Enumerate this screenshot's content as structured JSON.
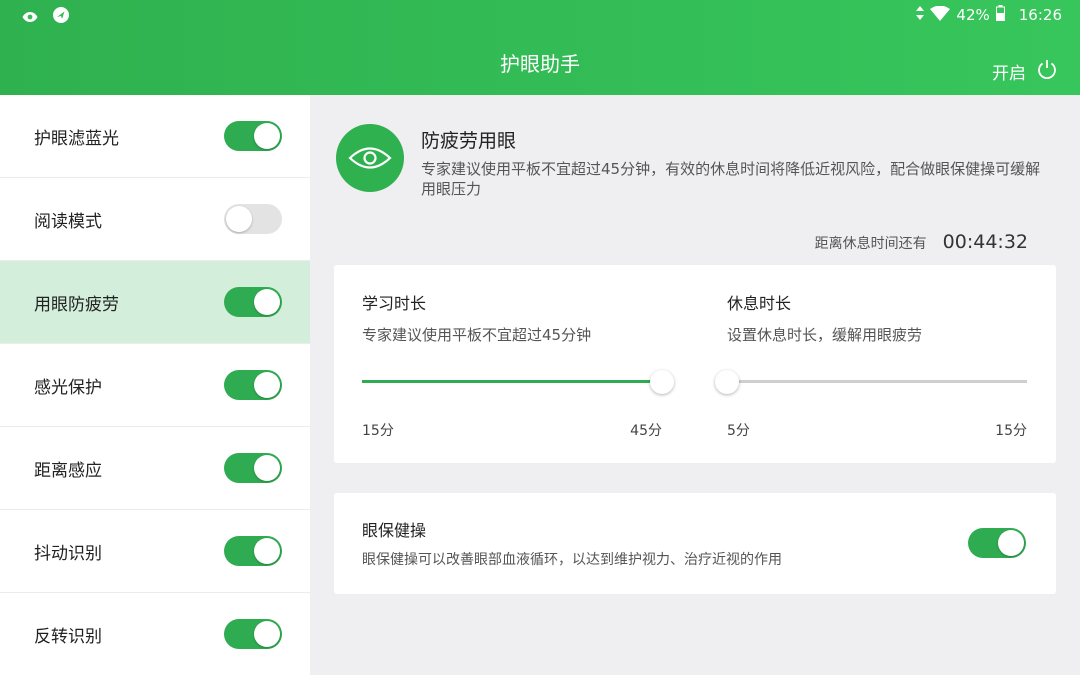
{
  "status_bar": {
    "battery": "42%",
    "time": "16:26"
  },
  "header": {
    "title": "护眼助手",
    "power_label": "开启"
  },
  "sidebar": {
    "items": [
      {
        "label": "护眼滤蓝光",
        "on": true
      },
      {
        "label": "阅读模式",
        "on": false
      },
      {
        "label": "用眼防疲劳",
        "on": true,
        "selected": true
      },
      {
        "label": "感光保护",
        "on": true
      },
      {
        "label": "距离感应",
        "on": true
      },
      {
        "label": "抖动识别",
        "on": true
      },
      {
        "label": "反转识别",
        "on": true
      }
    ]
  },
  "main": {
    "intro": {
      "title": "防疲劳用眼",
      "description": "专家建议使用平板不宜超过45分钟，有效的休息时间将降低近视风险，配合做眼保健操可缓解用眼压力"
    },
    "countdown": {
      "label": "距离休息时间还有",
      "value": "00:44:32"
    },
    "study": {
      "title": "学习时长",
      "description": "专家建议使用平板不宜超过45分钟",
      "min_label": "15分",
      "max_label": "45分",
      "level": 1.0
    },
    "rest": {
      "title": "休息时长",
      "description": "设置休息时长，缓解用眼疲劳",
      "min_label": "5分",
      "max_label": "15分",
      "level": 0.0
    },
    "eye_exercise": {
      "title": "眼保健操",
      "description": "眼保健操可以改善眼部血液循环，以达到维护视力、治疗近视的作用",
      "on": true
    }
  },
  "colors": {
    "accent": "#2fb14f",
    "selected_bg": "#d3efdb",
    "toggle_off": "#e3e3e3"
  }
}
